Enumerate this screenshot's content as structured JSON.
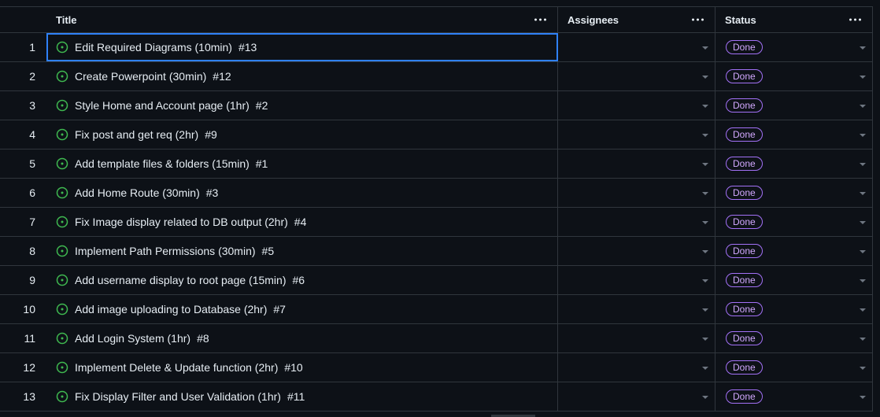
{
  "columns": {
    "title": "Title",
    "assignees": "Assignees",
    "status": "Status"
  },
  "rows": [
    {
      "num": "1",
      "title": "Edit Required Diagrams (10min)",
      "issue": "#13",
      "status": "Done"
    },
    {
      "num": "2",
      "title": "Create Powerpoint (30min)",
      "issue": "#12",
      "status": "Done"
    },
    {
      "num": "3",
      "title": "Style Home and Account page (1hr)",
      "issue": "#2",
      "status": "Done"
    },
    {
      "num": "4",
      "title": "Fix post and get req (2hr)",
      "issue": "#9",
      "status": "Done"
    },
    {
      "num": "5",
      "title": "Add template files & folders (15min)",
      "issue": "#1",
      "status": "Done"
    },
    {
      "num": "6",
      "title": "Add Home Route (30min)",
      "issue": "#3",
      "status": "Done"
    },
    {
      "num": "7",
      "title": "Fix Image display related to DB output (2hr)",
      "issue": "#4",
      "status": "Done"
    },
    {
      "num": "8",
      "title": "Implement Path Permissions (30min)",
      "issue": "#5",
      "status": "Done"
    },
    {
      "num": "9",
      "title": "Add username display to root page (15min)",
      "issue": "#6",
      "status": "Done"
    },
    {
      "num": "10",
      "title": "Add image uploading to Database (2hr)",
      "issue": "#7",
      "status": "Done"
    },
    {
      "num": "11",
      "title": "Add Login System (1hr)",
      "issue": "#8",
      "status": "Done"
    },
    {
      "num": "12",
      "title": "Implement Delete & Update function (2hr)",
      "issue": "#10",
      "status": "Done"
    },
    {
      "num": "13",
      "title": "Fix Display Filter and User Validation (1hr)",
      "issue": "#11",
      "status": "Done"
    }
  ],
  "colors": {
    "background": "#0d1117",
    "border": "#30363d",
    "open_issue_green": "#3fb950",
    "done_purple": "#a371f7",
    "selection_blue": "#2f81f7"
  },
  "icons": {
    "issue": "issue-opened-icon",
    "column_menu": "kebab-menu-icon",
    "dropdown": "caret-down-icon"
  }
}
